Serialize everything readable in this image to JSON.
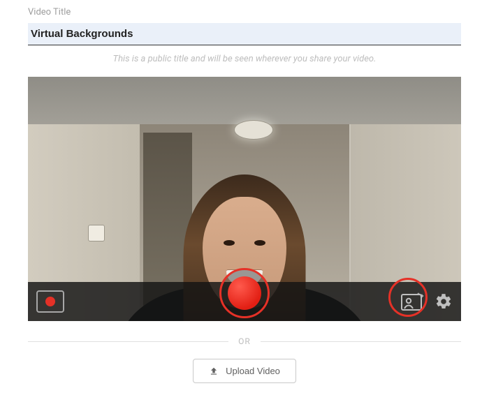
{
  "field": {
    "label": "Video Title",
    "value": "Virtual Backgrounds",
    "helper": "This is a public title and will be seen wherever you share your video."
  },
  "divider": {
    "label": "OR"
  },
  "upload": {
    "label": "Upload Video"
  },
  "icons": {
    "screen_record": "screen-record-icon",
    "record": "record-icon",
    "background": "background-effects-icon",
    "settings": "gear-icon",
    "upload": "upload-icon"
  },
  "colors": {
    "accent": "#e53127",
    "input_bg": "#eaf0f9"
  }
}
